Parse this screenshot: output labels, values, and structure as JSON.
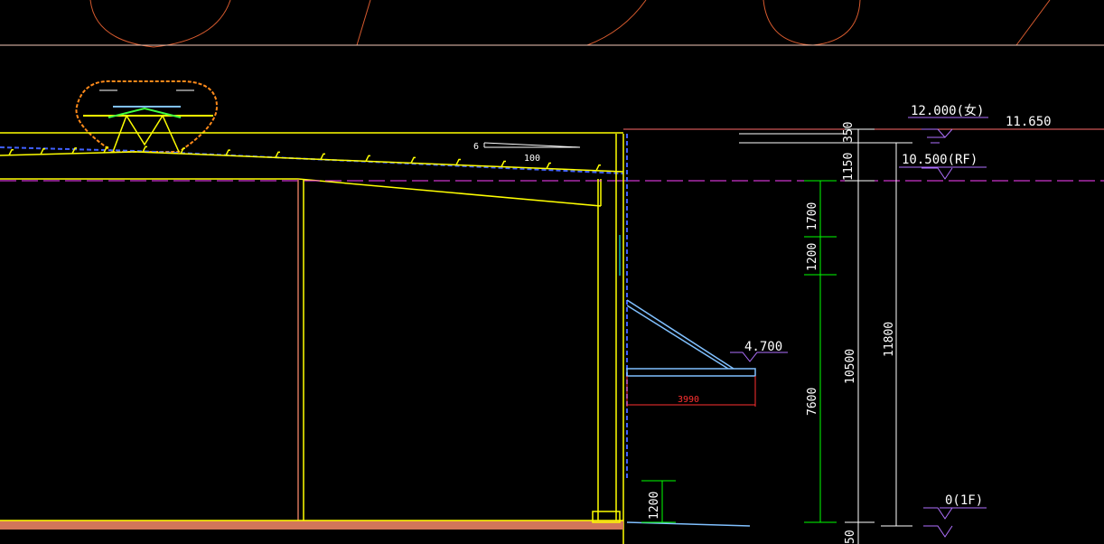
{
  "elevations": {
    "parapet": "12.000(女)",
    "top": "11.650",
    "roof": "10.500(RF)",
    "canopy": "4.700",
    "ground": "0(1F)"
  },
  "slope_note": {
    "rise": "6",
    "run": "100"
  },
  "dimensions": {
    "top_segment": "350",
    "roof_segment": "1150",
    "upper_a": "1700",
    "upper_b": "1200",
    "middle": "7600",
    "base": "1200",
    "bottom": "50",
    "roof_height": "10500",
    "overall_height": "11800",
    "canopy_width": "3990"
  },
  "colors": {
    "background": "#000000",
    "structure": "#ffff00",
    "roof_line": "#4060ff",
    "dimension": "#00ff00",
    "annotation": "#ffffff",
    "slab": "#d2765a",
    "outline": "#ff6a3a",
    "canopy": "#80c0ff",
    "magenta_line": "#ff40ff"
  }
}
